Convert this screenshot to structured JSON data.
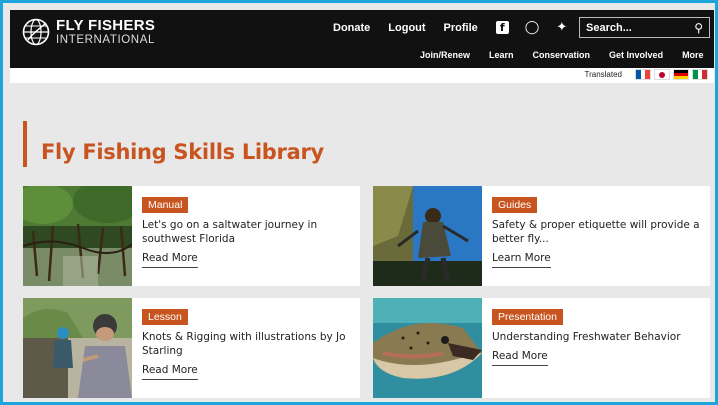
{
  "brand": {
    "line1": "FLY FISHERS",
    "line2": "INTERNATIONAL"
  },
  "topnav": [
    "Donate",
    "Logout",
    "Profile"
  ],
  "social": {
    "facebook": "facebook-icon",
    "instagram": "instagram-icon",
    "twitter": "twitter-icon"
  },
  "search": {
    "placeholder": "Search..."
  },
  "subnav": [
    "Join/Renew",
    "Learn",
    "Conservation",
    "Get Involved",
    "More"
  ],
  "translate": {
    "label": "Translated"
  },
  "flags": [
    "france",
    "japan",
    "germany",
    "italy"
  ],
  "page": {
    "title": "Fly Fishing Skills Library"
  },
  "cards": [
    {
      "badge": "Manual",
      "desc": "Let's go on a saltwater journey in southwest Florida",
      "link": "Read More"
    },
    {
      "badge": "Guides",
      "desc": "Safety & proper etiquette will provide a better fly...",
      "link": "Learn More"
    },
    {
      "badge": "Lesson",
      "desc": "Knots & Rigging with illustrations by Jo Starling",
      "link": "Read More"
    },
    {
      "badge": "Presentation",
      "desc": "Understanding Freshwater Behavior",
      "link": "Read More"
    }
  ],
  "colors": {
    "accent": "#c8541f",
    "header": "#111111",
    "frame": "#1ba5db"
  }
}
